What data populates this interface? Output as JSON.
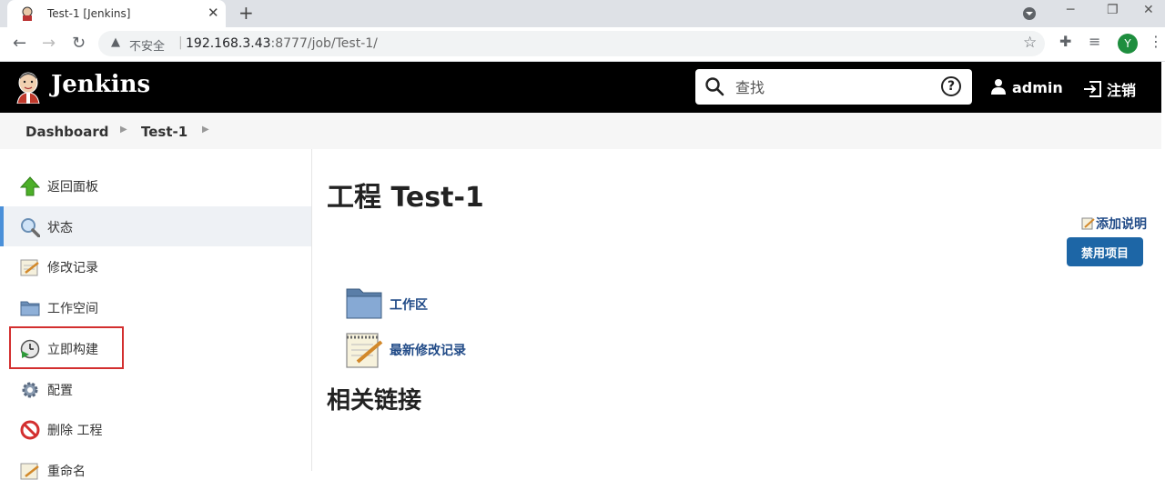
{
  "browser": {
    "tab_title": "Test-1 [Jenkins]",
    "url_host": "192.168.3.43",
    "url_rest": ":8777/job/Test-1/",
    "security_label": "不安全",
    "profile_initial": "Y"
  },
  "header": {
    "brand": "Jenkins",
    "search_placeholder": "查找",
    "user": "admin",
    "logout": "注销"
  },
  "breadcrumb": {
    "items": [
      {
        "label": "Dashboard"
      },
      {
        "label": "Test-1"
      }
    ]
  },
  "sidebar": {
    "items": [
      {
        "label": "返回面板",
        "icon": "up-arrow-icon"
      },
      {
        "label": "状态",
        "icon": "magnifier-icon",
        "active": true
      },
      {
        "label": "修改记录",
        "icon": "notepad-icon"
      },
      {
        "label": "工作空间",
        "icon": "folder-icon"
      },
      {
        "label": "立即构建",
        "icon": "build-clock-icon",
        "highlighted": true
      },
      {
        "label": "配置",
        "icon": "gear-icon"
      },
      {
        "label": "删除 工程",
        "icon": "no-entry-icon"
      },
      {
        "label": "重命名",
        "icon": "notepad-icon"
      }
    ]
  },
  "main": {
    "title": "工程 Test-1",
    "add_description": "添加说明",
    "disable_button": "禁用项目",
    "links": [
      {
        "label": "工作区",
        "icon": "folder-icon"
      },
      {
        "label": "最新修改记录",
        "icon": "notepad-icon"
      }
    ],
    "related_heading": "相关链接"
  },
  "colors": {
    "header_bg": "#000000",
    "link": "#204a87",
    "button": "#1d66a6",
    "highlight": "#d32f2f"
  }
}
